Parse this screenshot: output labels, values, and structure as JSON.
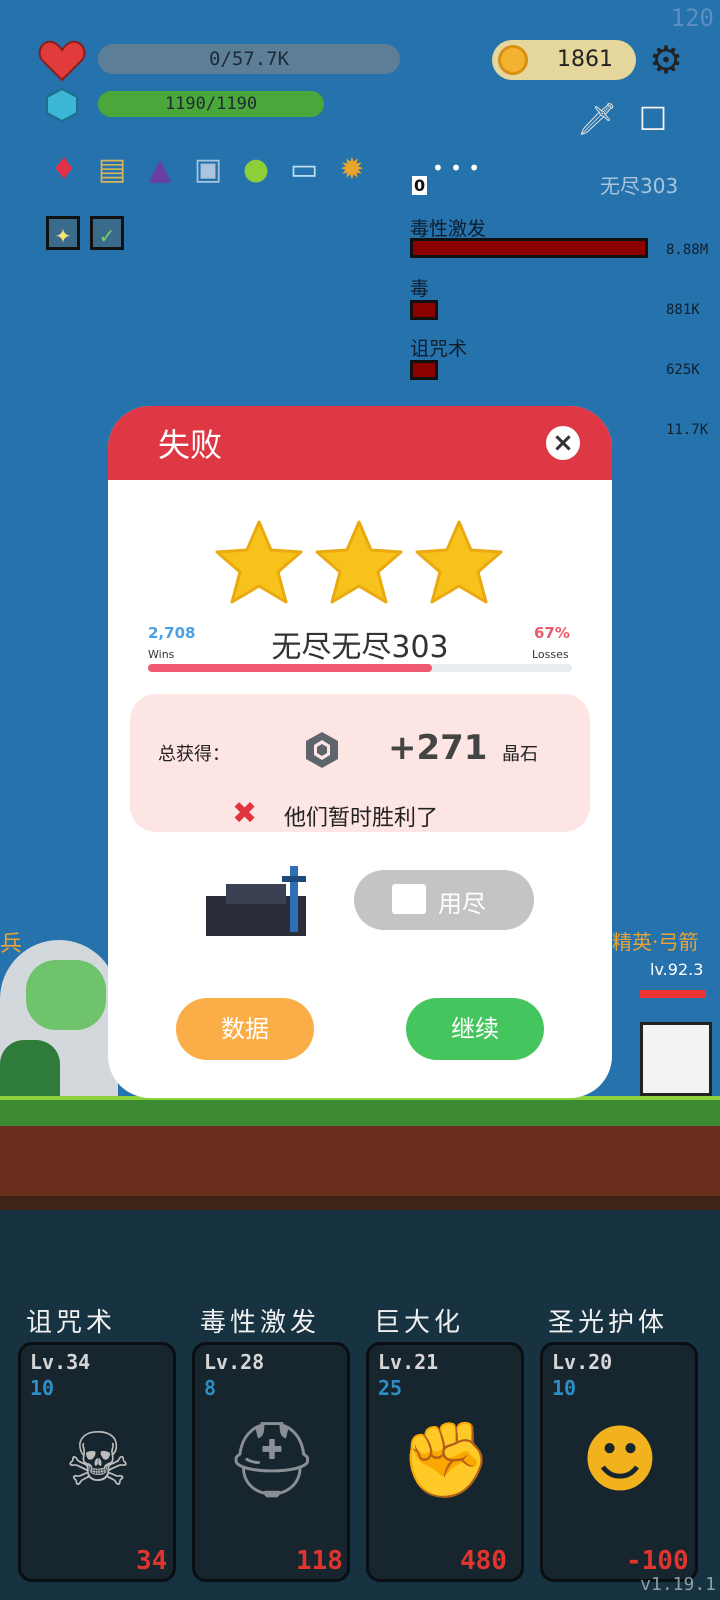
{
  "fps": "120",
  "hud": {
    "hp_text": "0/57.7K",
    "mp_text": "1190/1190",
    "coins": "1861",
    "stage_label": "无尽303",
    "counter": "0",
    "items": [
      "gem-icon",
      "scroll-icon",
      "wizard-hat-icon",
      "shirt-icon",
      "lime-icon",
      "card-icon",
      "pineapple-icon"
    ],
    "buffs": [
      "light-buff-icon",
      "sword-buff-icon"
    ]
  },
  "damage_stats": [
    {
      "name": "毒性激发",
      "value": "8.88M",
      "fraction": 1.0
    },
    {
      "name": "毒",
      "value": "881K",
      "fraction": 0.1
    },
    {
      "name": "诅咒术",
      "value": "625K",
      "fraction": 0.07
    },
    {
      "name": "",
      "value": "11.7K",
      "fraction": 0.0
    }
  ],
  "field": {
    "left_label": "兵",
    "right_label": "精英·弓箭",
    "right_level": "lv.92.3"
  },
  "modal": {
    "title": "失败",
    "close": "×",
    "stars": 3,
    "wins_value": "2,708",
    "wins_label": "Wins",
    "losses_pct": "67%",
    "losses_label": "Losses",
    "stage": "无尽无尽303",
    "progress": 0.67,
    "reward_label": "总获得：",
    "reward_value": "+271",
    "reward_unit": "晶石",
    "result_message": "他们暂时胜利了",
    "ad_button": "用尽",
    "stats_button": "数据",
    "continue_button": "继续"
  },
  "skills": [
    {
      "name": "诅咒术",
      "level": "Lv.34",
      "count": "10",
      "cost": "34",
      "icon": "skull-icon"
    },
    {
      "name": "毒性激发",
      "level": "Lv.28",
      "count": "8",
      "cost": "118",
      "icon": "viking-helmet-icon"
    },
    {
      "name": "巨大化",
      "level": "Lv.21",
      "count": "25",
      "cost": "480",
      "icon": "fist-icon"
    },
    {
      "name": "圣光护体",
      "level": "Lv.20",
      "count": "10",
      "cost": "-100",
      "icon": "golden-shield-icon"
    }
  ],
  "version": "v1.19.1",
  "colors": {
    "modal_header": "#dd3844",
    "stats_btn": "#fbae47",
    "continue_btn": "#45c55d",
    "star": "#f8c21d"
  }
}
